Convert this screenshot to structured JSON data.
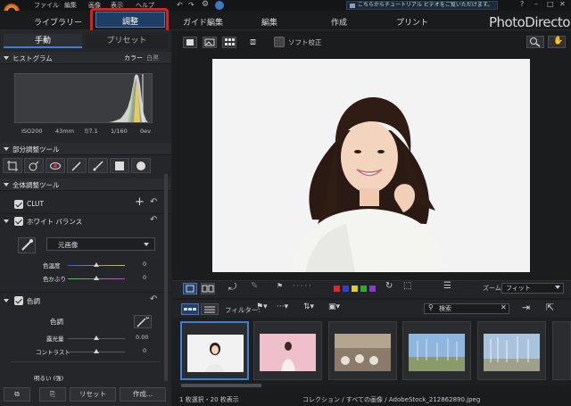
{
  "menu": {
    "items": [
      "ファイル",
      "編集",
      "画像",
      "表示",
      "ヘルプ"
    ]
  },
  "notice": "こちらからチュートリアル ビデオをご覧いただけます。",
  "window_controls": [
    "?",
    "–",
    "□",
    "✕"
  ],
  "brand": "PhotoDirector",
  "tabs": {
    "library": "ライブラリー",
    "adjust": "調整",
    "guided": "ガイド編集",
    "edit": "編集",
    "create": "作成",
    "print": "プリント"
  },
  "left": {
    "subtabs": {
      "manual": "手動",
      "preset": "プリセット"
    },
    "histogram": {
      "title": "ヒストグラム",
      "color": "カラー",
      "bw": "白黒",
      "info": [
        "ISO200",
        "43mm",
        "f/7.1",
        "1/160",
        "0ev"
      ]
    },
    "partial": {
      "title": "部分調整ツール"
    },
    "global": {
      "title": "全体調整ツール"
    },
    "clut": "CLUT",
    "wb": {
      "title": "ホワイト バランス",
      "preset": "元画像",
      "temp": "色温度",
      "tint": "色かぶり",
      "temp_val": "0",
      "tint_val": "0"
    },
    "tone": {
      "title": "色調",
      "sub": "色調",
      "exposure": "露光量",
      "exposure_val": "0.00",
      "contrast": "コントラスト",
      "contrast_val": "0",
      "bright": "明るい (強)"
    },
    "buttons": {
      "reset": "リセット",
      "create": "作成..."
    }
  },
  "toolbar": {
    "soft_proof": "ソフト校正",
    "zoom_label": "ズーム:",
    "zoom_value": "フィット"
  },
  "filter": {
    "label": "フィルター:",
    "search_placeholder": "検索"
  },
  "status": {
    "left": "1 枚選択・20 枚表示",
    "center": "コレクション / すべての画像 / AdobeStock_212862890.jpeg"
  },
  "colors": {
    "accent": "#3d7fd1",
    "highlight": "#e01e1e",
    "labels": [
      "#d22b2b",
      "#2f3fd0",
      "#d6cf2c",
      "#33a63a",
      "#8a3bc4"
    ]
  }
}
